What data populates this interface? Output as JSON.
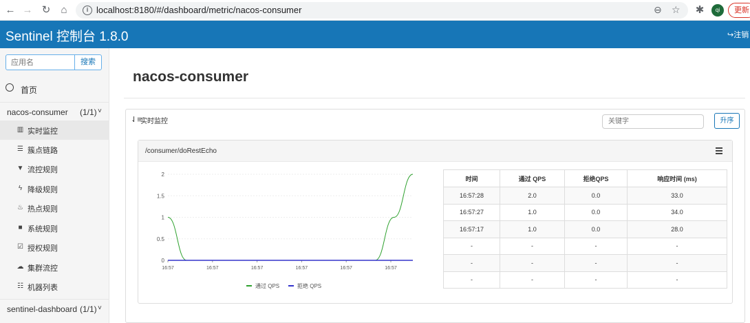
{
  "browser": {
    "url": "localhost:8180/#/dashboard/metric/nacos-consumer",
    "avatar": "qi",
    "update_label": "更新"
  },
  "header": {
    "title": "Sentinel 控制台 1.8.0",
    "logout": "注销"
  },
  "sidebar": {
    "search_placeholder": "应用名",
    "search_label": "搜索",
    "home_label": "首页",
    "apps": [
      {
        "name": "nacos-consumer",
        "count": "(1/1)"
      },
      {
        "name": "sentinel-dashboard",
        "count": "(1/1)"
      }
    ],
    "items": [
      {
        "label": "实时监控",
        "icon": "bar-chart-icon"
      },
      {
        "label": "簇点链路",
        "icon": "list-icon"
      },
      {
        "label": "流控规则",
        "icon": "filter-icon"
      },
      {
        "label": "降级规则",
        "icon": "flash-icon"
      },
      {
        "label": "热点规则",
        "icon": "fire-icon"
      },
      {
        "label": "系统规则",
        "icon": "lock-icon"
      },
      {
        "label": "授权规则",
        "icon": "check-icon"
      },
      {
        "label": "集群流控",
        "icon": "cloud-icon"
      },
      {
        "label": "机器列表",
        "icon": "th-list-icon"
      }
    ]
  },
  "main": {
    "title": "nacos-consumer",
    "panel_title": "实时监控",
    "keyword_placeholder": "关键字",
    "sort_label": "升序",
    "resource": "/consumer/doRestEcho"
  },
  "chart_data": {
    "type": "line",
    "x_tick_labels": [
      "16:57",
      "16:57",
      "16:57",
      "16:57",
      "16:57",
      "16:57"
    ],
    "y_ticks": [
      "2",
      "1.5",
      "1",
      "0.5",
      "0"
    ],
    "ylim": [
      0,
      2
    ],
    "legend": [
      "通过 QPS",
      "拒绝 QPS"
    ],
    "colors": {
      "pass": "#2ca02c",
      "block": "#3333cc"
    },
    "series": [
      {
        "name": "通过 QPS",
        "values": [
          1,
          0,
          0,
          0,
          0,
          0,
          0,
          0,
          0,
          0,
          0,
          0,
          1,
          2
        ]
      },
      {
        "name": "拒绝 QPS",
        "values": [
          0,
          0,
          0,
          0,
          0,
          0,
          0,
          0,
          0,
          0,
          0,
          0,
          0,
          0
        ]
      }
    ]
  },
  "table": {
    "headers": [
      "时间",
      "通过 QPS",
      "拒绝QPS",
      "响应时间 (ms)"
    ],
    "rows": [
      [
        "16:57:28",
        "2.0",
        "0.0",
        "33.0"
      ],
      [
        "16:57:27",
        "1.0",
        "0.0",
        "34.0"
      ],
      [
        "16:57:17",
        "1.0",
        "0.0",
        "28.0"
      ],
      [
        "-",
        "-",
        "-",
        "-"
      ],
      [
        "-",
        "-",
        "-",
        "-"
      ],
      [
        "-",
        "-",
        "-",
        "-"
      ]
    ]
  }
}
